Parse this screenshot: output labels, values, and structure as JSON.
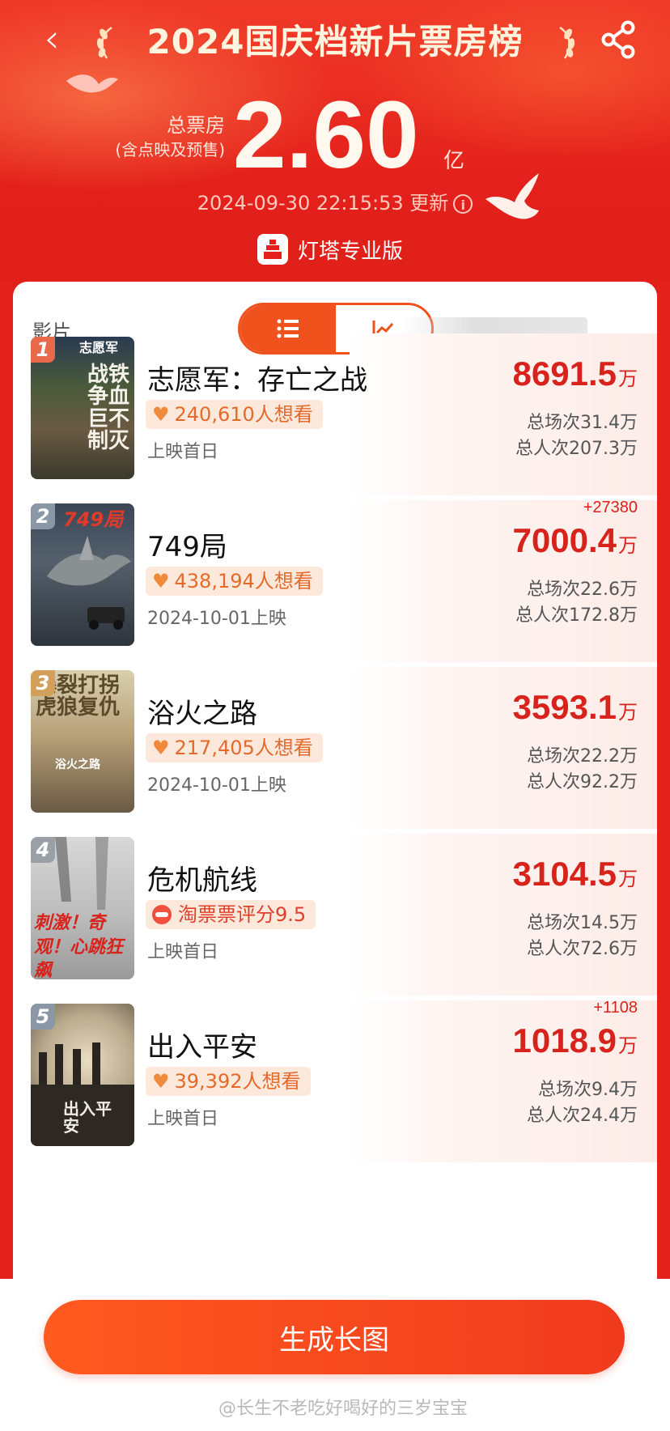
{
  "header": {
    "title": "2024国庆档新片票房榜",
    "back_glyph": "‹",
    "total_label_line1": "总票房",
    "total_label_line2": "(含点映及预售)",
    "total_value": "2.60",
    "total_unit": "亿",
    "update_time": "2024-09-30 22:15:53 更新",
    "info_glyph": "i",
    "brand": "灯塔专业版",
    "colors": {
      "hero_red": "#e3201b",
      "title_cream": "#fff4de"
    }
  },
  "list_header": {
    "column_label": "影片"
  },
  "films": [
    {
      "rank": "1",
      "title": "志愿军：存亡之战",
      "tag": "240,610人想看",
      "tag_icon": "heart-icon",
      "release": "上映首日",
      "delta": "",
      "gross": "8691.5",
      "gross_unit": "万",
      "shows": "总场次31.4万",
      "admissions": "总人次207.3万",
      "poster_text": "战铁争血巨不制灭",
      "poster_header": "志愿军"
    },
    {
      "rank": "2",
      "title": "749局",
      "tag": "438,194人想看",
      "tag_icon": "heart-icon",
      "release": "2024-10-01上映",
      "delta": "+27380",
      "gross": "7000.4",
      "gross_unit": "万",
      "shows": "总场次22.6万",
      "admissions": "总人次172.8万",
      "poster_header": "749局"
    },
    {
      "rank": "3",
      "title": "浴火之路",
      "tag": "217,405人想看",
      "tag_icon": "heart-icon",
      "release": "2024-10-01上映",
      "delta": "",
      "gross": "3593.1",
      "gross_unit": "万",
      "shows": "总场次22.2万",
      "admissions": "总人次92.2万",
      "poster_header": "爆裂打拐虎狼复仇",
      "poster_sub": "浴火之路"
    },
    {
      "rank": "4",
      "title": "危机航线",
      "tag": "淘票票评分9.5",
      "tag_icon": "taopiaopiao-icon",
      "release": "上映首日",
      "delta": "",
      "gross": "3104.5",
      "gross_unit": "万",
      "shows": "总场次14.5万",
      "admissions": "总人次72.6万",
      "poster_text": "刺激！奇观！心跳狂飙"
    },
    {
      "rank": "5",
      "title": "出入平安",
      "tag": "39,392人想看",
      "tag_icon": "heart-icon",
      "release": "上映首日",
      "delta": "+1108",
      "gross": "1018.9",
      "gross_unit": "万",
      "shows": "总场次9.4万",
      "admissions": "总人次24.4万",
      "poster_sub": "出入平安"
    }
  ],
  "bottom": {
    "generate_button": "生成长图",
    "watermark": "@长生不老吃好喝好的三岁宝宝"
  }
}
